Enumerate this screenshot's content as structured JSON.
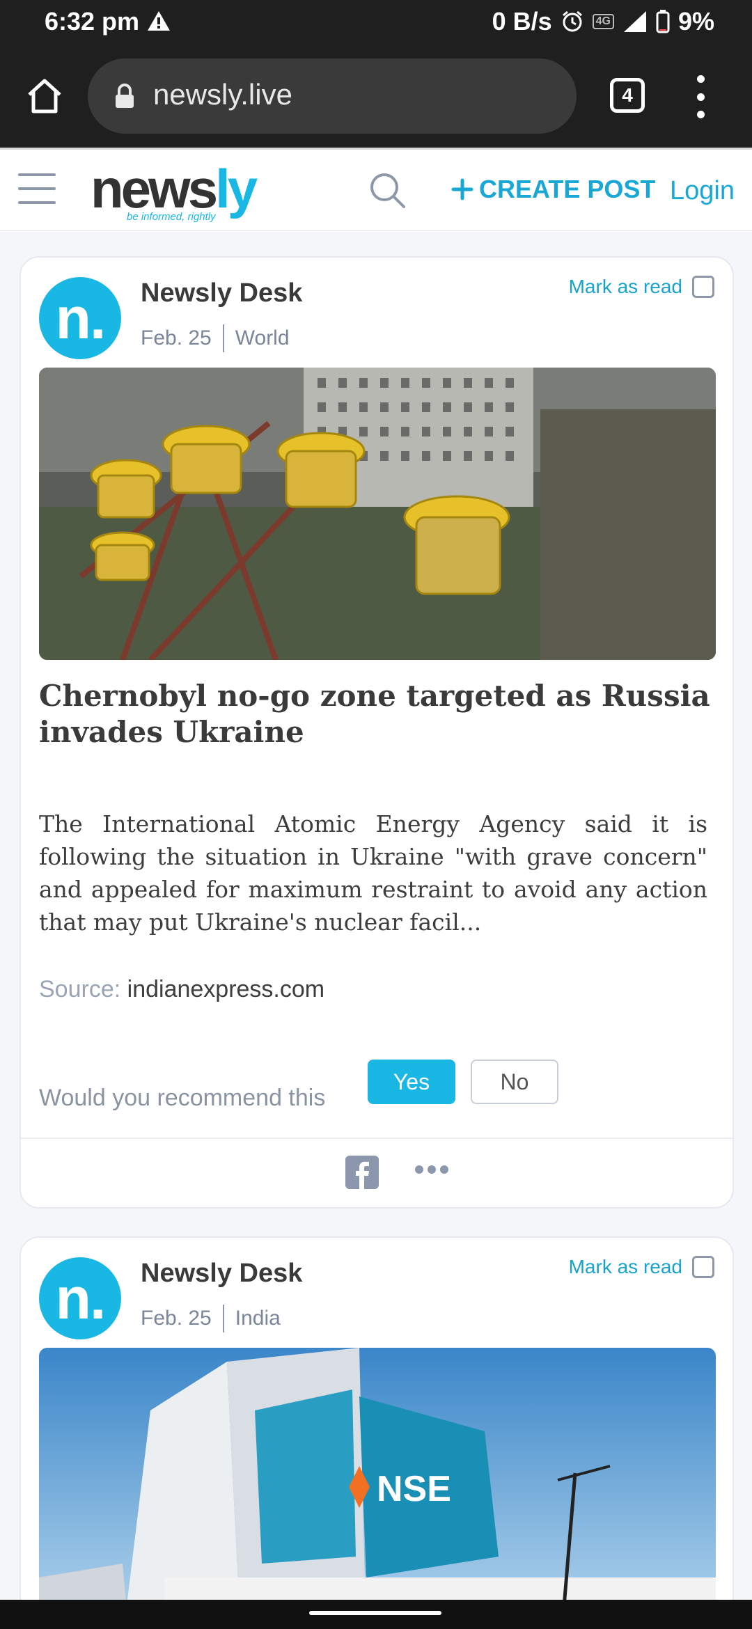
{
  "status_bar": {
    "time": "6:32 pm",
    "net_speed": "0 B/s",
    "network": "4G",
    "battery": "9%"
  },
  "browser": {
    "url": "newsly.live",
    "tab_count": "4"
  },
  "header": {
    "logo_main": "news",
    "logo_accent": "ly",
    "tagline": "be informed, rightly",
    "create_post": "CREATE POST",
    "login": "Login"
  },
  "posts": [
    {
      "author": "Newsly Desk",
      "avatar_letter": "n.",
      "date": "Feb. 25",
      "category": "World",
      "mark_as_read": "Mark as read",
      "headline": "Chernobyl no-go zone targeted as Russia invades Ukraine",
      "excerpt": "The International Atomic Energy Agency said it is following the situation in Ukraine \"with grave concern\" and appealed for maximum restraint to avoid any action that may put Ukraine's nuclear facil...",
      "source_label": "Source:",
      "source": "indianexpress.com",
      "recommend_prompt": "Would you recommend this",
      "yes": "Yes",
      "no": "No"
    },
    {
      "author": "Newsly Desk",
      "avatar_letter": "n.",
      "date": "Feb. 25",
      "category": "India",
      "mark_as_read": "Mark as read",
      "image_sign": "NSE"
    }
  ],
  "colors": {
    "brand": "#19b7e3",
    "link": "#19a8d6",
    "muted": "#8a93a2"
  }
}
